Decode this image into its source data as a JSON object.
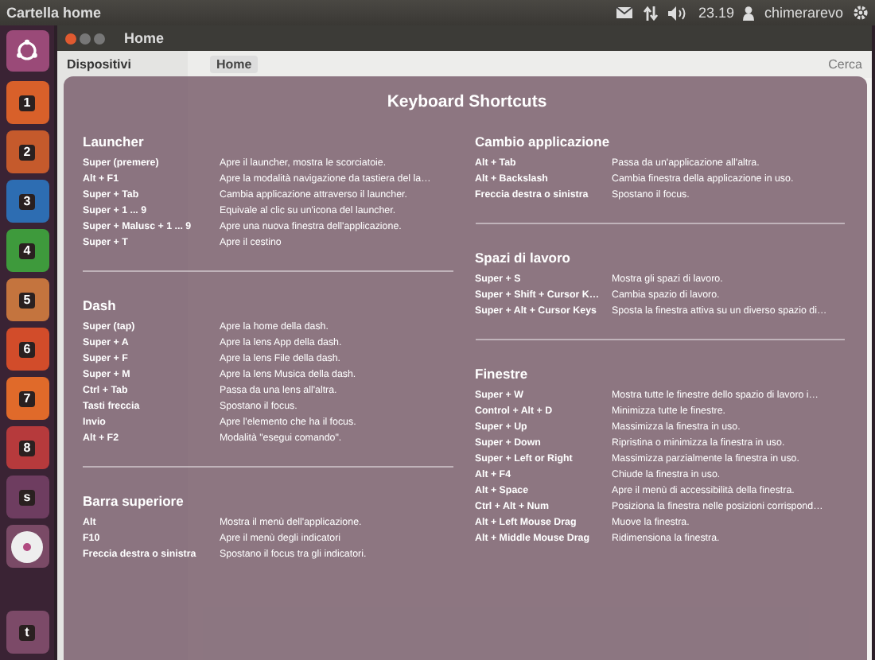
{
  "top_panel": {
    "title": "Cartella home",
    "clock": "23.19",
    "user": "chimerarevo"
  },
  "launcher": {
    "items": [
      {
        "badge": "1",
        "color": "#d8602a"
      },
      {
        "badge": "2",
        "color": "#c55a2c"
      },
      {
        "badge": "3",
        "color": "#2d6db2"
      },
      {
        "badge": "4",
        "color": "#3e9a3c"
      },
      {
        "badge": "5",
        "color": "#c4743e"
      },
      {
        "badge": "6",
        "color": "#d24c2a"
      },
      {
        "badge": "7",
        "color": "#e06a2a"
      },
      {
        "badge": "8",
        "color": "#b63a3c"
      },
      {
        "badge": "s",
        "color": "#6e3d60"
      },
      {
        "badge": "t",
        "color": "#7c4a68"
      }
    ]
  },
  "window": {
    "title": "Home",
    "sidebar_heading": "Dispositivi",
    "breadcrumb": "Home",
    "search_placeholder": "Cerca"
  },
  "overlay": {
    "title": "Keyboard Shortcuts",
    "columns": [
      [
        {
          "heading": "Launcher",
          "rows": [
            {
              "keys": "Super (premere)",
              "action": "Apre il launcher, mostra le scorciatoie."
            },
            {
              "keys": "Alt + F1",
              "action": "Apre la modalità navigazione da tastiera del la…"
            },
            {
              "keys": "Super + Tab",
              "action": "Cambia applicazione attraverso il launcher."
            },
            {
              "keys": "Super + 1 ... 9",
              "action": "Equivale al clic su un'icona del launcher."
            },
            {
              "keys": "Super + Malusc + 1 ... 9",
              "action": "Apre una nuova finestra dell'applicazione."
            },
            {
              "keys": "Super + T",
              "action": "Apre il cestino"
            }
          ]
        },
        {
          "heading": "Dash",
          "rows": [
            {
              "keys": "Super (tap)",
              "action": "Apre la home della dash."
            },
            {
              "keys": "Super + A",
              "action": "Apre la lens App della dash."
            },
            {
              "keys": "Super + F",
              "action": "Apre la lens File della dash."
            },
            {
              "keys": "Super + M",
              "action": "Apre la lens Musica della dash."
            },
            {
              "keys": "Ctrl + Tab",
              "action": "Passa da una lens all'altra."
            },
            {
              "keys": "Tasti freccia",
              "action": "Spostano il focus."
            },
            {
              "keys": "Invio",
              "action": "Apre l'elemento che ha il focus."
            },
            {
              "keys": "Alt + F2",
              "action": "Modalità \"esegui comando\"."
            }
          ]
        },
        {
          "heading": "Barra superiore",
          "rows": [
            {
              "keys": "Alt",
              "action": "Mostra il menù dell'applicazione."
            },
            {
              "keys": "F10",
              "action": "Apre il menù degli indicatori"
            },
            {
              "keys": "Freccia destra o sinistra",
              "action": "Spostano il focus tra gli indicatori."
            }
          ]
        }
      ],
      [
        {
          "heading": "Cambio applicazione",
          "rows": [
            {
              "keys": "Alt + Tab",
              "action": "Passa da un'applicazione all'altra."
            },
            {
              "keys": "Alt + Backslash",
              "action": "Cambia finestra della applicazione in uso."
            },
            {
              "keys": "Freccia destra o sinistra",
              "action": "Spostano il focus."
            }
          ]
        },
        {
          "heading": "Spazi di lavoro",
          "rows": [
            {
              "keys": "Super + S",
              "action": "Mostra gli spazi di lavoro."
            },
            {
              "keys": "Super + Shift + Cursor K…",
              "action": "Cambia spazio di lavoro."
            },
            {
              "keys": "Super + Alt + Cursor Keys",
              "action": "Sposta la finestra attiva su un diverso spazio di…"
            }
          ]
        },
        {
          "heading": "Finestre",
          "rows": [
            {
              "keys": "Super + W",
              "action": "Mostra tutte le finestre dello spazio di lavoro i…"
            },
            {
              "keys": "Control + Alt + D",
              "action": "Minimizza tutte le finestre."
            },
            {
              "keys": "Super + Up",
              "action": "Massimizza la finestra in uso."
            },
            {
              "keys": "Super + Down",
              "action": "Ripristina o minimizza la finestra in uso."
            },
            {
              "keys": "Super + Left or Right",
              "action": "Massimizza parzialmente la finestra in uso."
            },
            {
              "keys": "Alt + F4",
              "action": "Chiude la finestra in uso."
            },
            {
              "keys": "Alt + Space",
              "action": "Apre il menù di accessibilità della finestra."
            },
            {
              "keys": "Ctrl + Alt + Num",
              "action": "Posiziona la finestra nelle posizioni corrispond…"
            },
            {
              "keys": "Alt + Left Mouse Drag",
              "action": "Muove la finestra."
            },
            {
              "keys": "Alt + Middle Mouse Drag",
              "action": "Ridimensiona la finestra."
            }
          ]
        }
      ]
    ]
  }
}
